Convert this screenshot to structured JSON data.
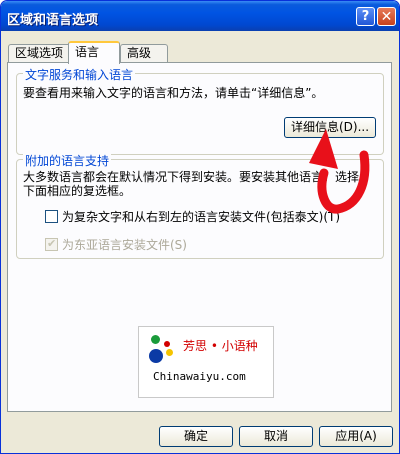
{
  "window": {
    "title": "区域和语言选项"
  },
  "titlebar_buttons": {
    "help": "?",
    "close": "✕"
  },
  "tabs": [
    {
      "label": "区域选项"
    },
    {
      "label": "语言",
      "selected": true
    },
    {
      "label": "高级"
    }
  ],
  "text_services": {
    "legend": "文字服务和输入语言",
    "description": "要查看用来输入文字的语言和方法，请单击“详细信息”。",
    "details_button": "详细信息(D)..."
  },
  "supplemental": {
    "legend": "附加的语言支持",
    "description_line1": "大多数语言都会在默认情况下得到安装。要安装其他语言，选择",
    "description_line2": "下面相应的复选框。",
    "checkbox_complex": {
      "label": "为复杂文字和从右到左的语言安装文件(包括泰文)(T)",
      "checked": false
    },
    "checkbox_east_asian": {
      "label": "为东亚语言安装文件(S)",
      "checked": true,
      "disabled": true
    }
  },
  "watermark": {
    "title": "芳思 • 小语种",
    "url": "Chinawaiyu.com"
  },
  "footer": {
    "ok": "确定",
    "cancel": "取消",
    "apply": "应用(A)"
  },
  "colors": {
    "title_bar": "#0054e3",
    "group_legend": "#0046d5",
    "arrow": "#e8101a",
    "watermark_title": "#d20000"
  }
}
